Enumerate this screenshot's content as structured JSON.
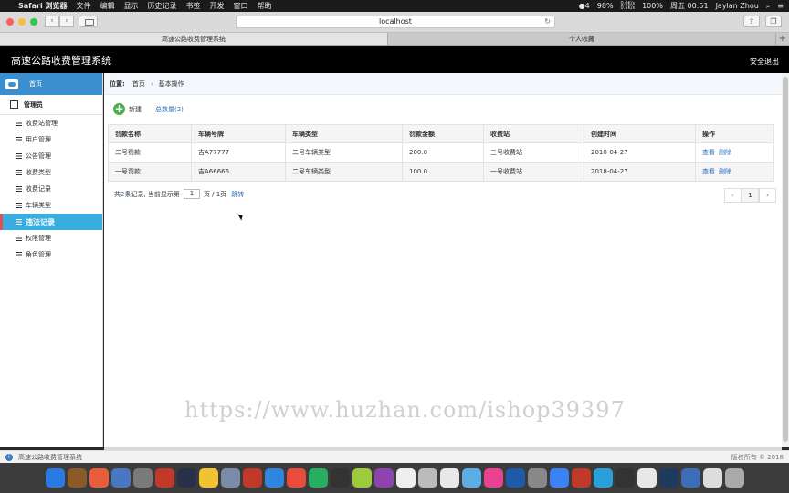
{
  "menubar": {
    "app_name": "Safari 浏览器",
    "items": [
      "文件",
      "编辑",
      "显示",
      "历史记录",
      "书签",
      "开发",
      "窗口",
      "帮助"
    ],
    "status": {
      "notifications": "4",
      "battery_extra": "98%",
      "network_down": "0.0K/s",
      "network_up": "0.5K/s",
      "battery": "100%",
      "clock": "周五 00:51",
      "user": "Jaylan Zhou"
    }
  },
  "browser": {
    "url": "localhost",
    "tabs": [
      {
        "label": "高速公路收费管理系统",
        "active": true
      },
      {
        "label": "个人收藏",
        "active": false
      }
    ]
  },
  "header": {
    "title": "高速公路收费管理系统",
    "logout": "安全退出"
  },
  "sidebar": {
    "home": "首页",
    "section": "管理员",
    "items": [
      {
        "label": "收费站管理",
        "active": false
      },
      {
        "label": "用户管理",
        "active": false
      },
      {
        "label": "公告管理",
        "active": false
      },
      {
        "label": "收费类型",
        "active": false
      },
      {
        "label": "收费记录",
        "active": false
      },
      {
        "label": "车辆类型",
        "active": false
      },
      {
        "label": "违法记录",
        "active": true
      },
      {
        "label": "权限管理",
        "active": false
      },
      {
        "label": "角色管理",
        "active": false
      }
    ]
  },
  "breadcrumb": {
    "label": "位置:",
    "home": "首页",
    "current": "基本操作"
  },
  "actions": {
    "new_label": "新建",
    "total_label": "总数量(2)"
  },
  "table": {
    "columns": [
      "罚款名称",
      "车辆号牌",
      "车辆类型",
      "罚款金额",
      "收费站",
      "创建时间",
      "操作"
    ],
    "rows": [
      {
        "name": "二号罚款",
        "plate": "吉A77777",
        "vehicle_type": "二号车辆类型",
        "amount": "200.0",
        "station": "三号收费站",
        "created": "2018-04-27",
        "view": "查看",
        "delete": "删除"
      },
      {
        "name": "一号罚款",
        "plate": "吉A66666",
        "vehicle_type": "二号车辆类型",
        "amount": "100.0",
        "station": "一号收费站",
        "created": "2018-04-27",
        "view": "查看",
        "delete": "删除"
      }
    ]
  },
  "pager": {
    "prefix": "共",
    "count": "2",
    "suffix": "条记录,  当前显示第",
    "page": "1",
    "total_pages": "页 / 1页",
    "jump": "跳转",
    "current_page": "1",
    "prev": "‹",
    "next": "›"
  },
  "watermark": "https://www.huzhan.com/ishop39397",
  "footer": {
    "system_name": "高速公路收费管理系统",
    "copyright": "版权所有 © 2018"
  },
  "dock_colors": [
    "#2a7ae2",
    "#8b5a2b",
    "#e85d3c",
    "#4a78c0",
    "#7a7a7a",
    "#c0392b",
    "#27324a",
    "#f1c232",
    "#7b8ca8",
    "#c0392b",
    "#2e86de",
    "#e74c3c",
    "#27ae60",
    "#333",
    "#9ccc3c",
    "#8e44ad",
    "#eee",
    "#bbb",
    "#e8e8e8",
    "#5dade2",
    "#e84393",
    "#1e5aa8",
    "#888",
    "#3b82f6",
    "#c0392b",
    "#2aa0d8",
    "#333",
    "#e8e8e8",
    "#1e3a5f",
    "#3d6db5",
    "#ddd",
    "#aaa"
  ]
}
